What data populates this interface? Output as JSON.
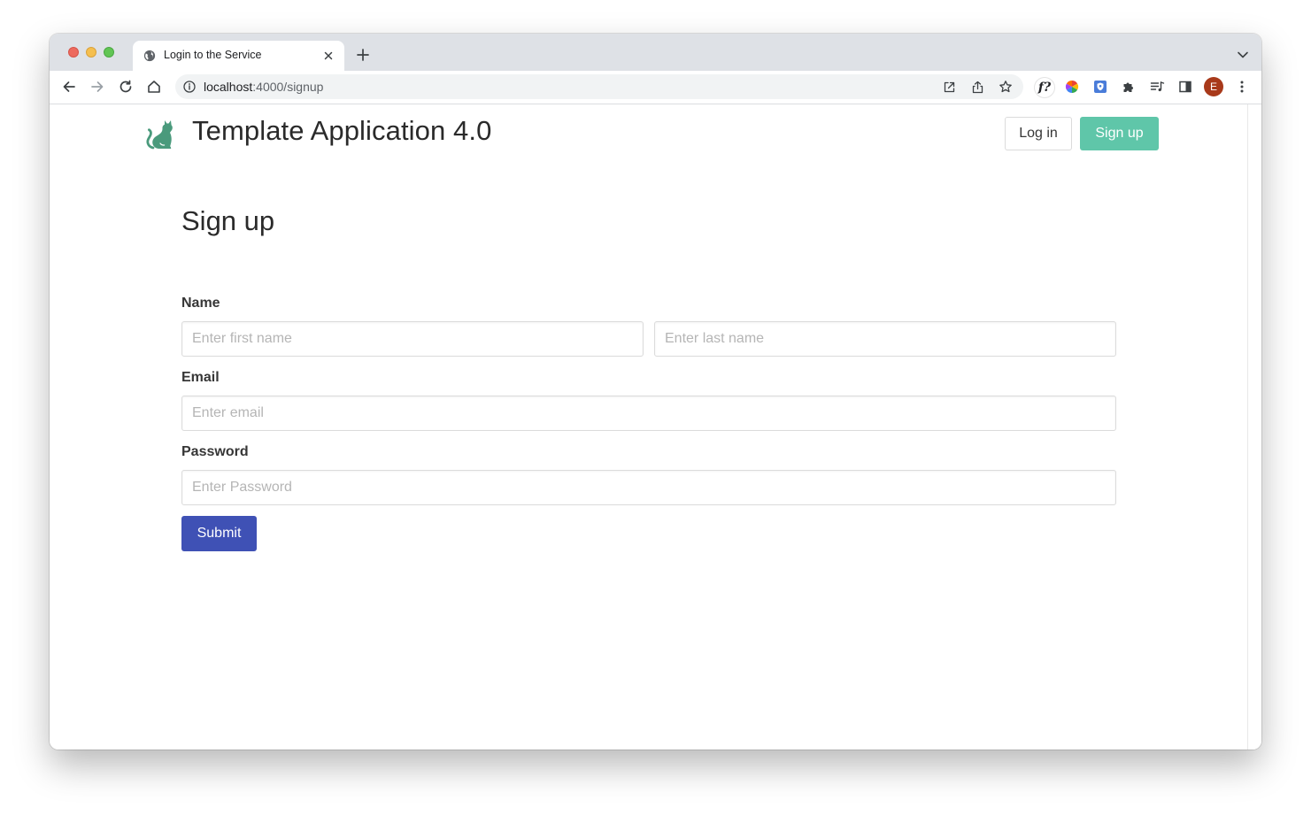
{
  "browser": {
    "tab_title": "Login to the Service",
    "url_host": "localhost",
    "url_path": ":4000/signup",
    "profile_initial": "E",
    "extension_label": "f?"
  },
  "header": {
    "brand": "Template Application 4.0",
    "login_label": "Log in",
    "signup_label": "Sign up"
  },
  "form": {
    "heading": "Sign up",
    "name_label": "Name",
    "first_name_placeholder": "Enter first name",
    "last_name_placeholder": "Enter last name",
    "email_label": "Email",
    "email_placeholder": "Enter email",
    "password_label": "Password",
    "password_placeholder": "Enter Password",
    "submit_label": "Submit"
  },
  "colors": {
    "brand_green": "#4a9a7c",
    "signup_button": "#5fc6a9",
    "submit_button": "#3f51b5",
    "avatar": "#a8391a"
  },
  "icons": {
    "favicon": "globe-icon",
    "logo": "cat-logo-icon"
  }
}
